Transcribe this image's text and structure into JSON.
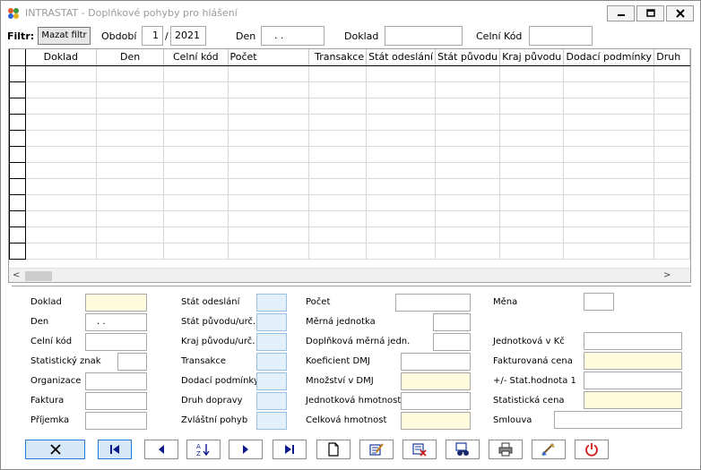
{
  "window": {
    "title": "INTRASTAT - Doplňkové pohyby pro hlášení",
    "controls": [
      "minimize",
      "restore",
      "close"
    ]
  },
  "filter": {
    "label": "Filtr:",
    "clear_button": "Mazat filtr",
    "period_label": "Období",
    "period_month": "1",
    "period_separator": "/",
    "period_year": "2021",
    "day_label": "Den",
    "day_value": ". .",
    "doc_label": "Doklad",
    "doc_value": "",
    "customs_label": "Celní Kód",
    "customs_value": ""
  },
  "grid": {
    "columns": [
      "Doklad",
      "Den",
      "Celní kód",
      "Počet",
      "Transakce",
      "Stát odeslání",
      "Stát původu",
      "Kraj původu",
      "Dodací podmínky",
      "Druh"
    ],
    "rows": 12
  },
  "form": {
    "doklad_label": "Doklad",
    "doklad_value": "",
    "den_label": "Den",
    "den_value": ". .",
    "celni_kod_label": "Celní kód",
    "celni_kod_value": "",
    "stat_znak_label": "Statistický znak",
    "stat_znak_value": "",
    "organizace_label": "Organizace",
    "organizace_value": "",
    "faktura_label": "Faktura",
    "faktura_value": "",
    "prijemka_label": "Příjemka",
    "prijemka_value": "",
    "stat_odeslani_label": "Stát odeslání",
    "stat_odeslani_value": "",
    "stat_puvodu_label": "Stát původu/urč.",
    "stat_puvodu_value": "",
    "kraj_puvodu_label": "Kraj původu/urč.",
    "kraj_puvodu_value": "",
    "transakce_label": "Transakce",
    "transakce_value": "",
    "dodaci_label": "Dodací podmínky",
    "dodaci_value": "",
    "druh_dopravy_label": "Druh dopravy",
    "druh_dopravy_value": "",
    "zvlastni_label": "Zvláštní pohyb",
    "zvlastni_value": "",
    "pocet_label": "Počet",
    "pocet_value": "",
    "merna_label": "Měrná jednotka",
    "merna_value": "",
    "doplnkova_label": "Doplňková měrná jedn.",
    "doplnkova_value": "",
    "koeficient_label": "Koeficient DMJ",
    "koeficient_value": "",
    "mnozstvi_label": "Množství v DMJ",
    "mnozstvi_value": "",
    "jedn_hmotnost_label": "Jednotková hmotnost",
    "jedn_hmotnost_value": "",
    "celk_hmotnost_label": "Celková hmotnost",
    "celk_hmotnost_value": "",
    "mena_label": "Měna",
    "mena_value": "",
    "jedn_kc_label": "Jednotková v Kč",
    "jedn_kc_value": "",
    "fakt_cena_label": "Fakturovaná cena",
    "fakt_cena_value": "",
    "stat_hodnota_label": "+/- Stat.hodnota 1",
    "stat_hodnota_value": "",
    "stat_cena_label": "Statistická cena",
    "stat_cena_value": "",
    "smlouva_label": "Smlouva",
    "smlouva_value": ""
  },
  "toolbar": {
    "buttons": [
      "close-icon",
      "first-record-icon",
      "previous-icon",
      "sort-az-icon",
      "next-icon",
      "last-record-icon",
      "new-document-icon",
      "edit-icon",
      "delete-icon",
      "binoculars-icon",
      "print-icon",
      "settings-icon",
      "power-icon"
    ]
  },
  "colors": {
    "yellow_field": "#fffbdc",
    "blue_field": "#e2f0fc",
    "active_button": "#d6e8f8",
    "power_red": "#d01818"
  }
}
